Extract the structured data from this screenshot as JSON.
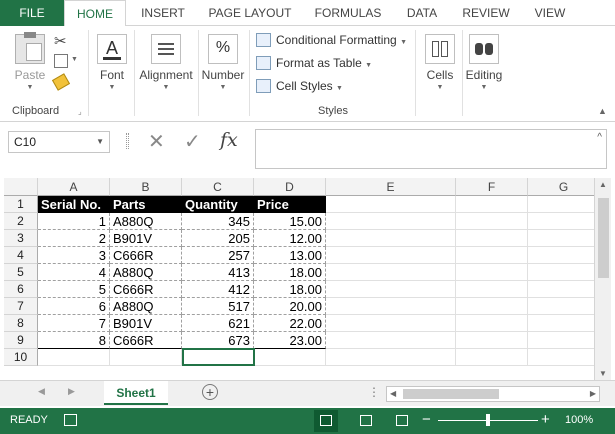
{
  "ribbon_tabs": [
    "FILE",
    "HOME",
    "INSERT",
    "PAGE LAYOUT",
    "FORMULAS",
    "DATA",
    "REVIEW",
    "VIEW"
  ],
  "clipboard": {
    "paste": "Paste",
    "group": "Clipboard"
  },
  "font": {
    "label": "Font"
  },
  "alignment": {
    "label": "Alignment"
  },
  "number": {
    "label": "Number"
  },
  "styles": {
    "conditional": "Conditional Formatting",
    "table": "Format as Table",
    "cell_styles": "Cell Styles",
    "group": "Styles"
  },
  "cells": {
    "label": "Cells"
  },
  "editing": {
    "label": "Editing"
  },
  "formula_bar": {
    "name_box": "C10",
    "fx": "fx",
    "value": ""
  },
  "columns": [
    "A",
    "B",
    "C",
    "D",
    "E",
    "F",
    "G"
  ],
  "rows": [
    "1",
    "2",
    "3",
    "4",
    "5",
    "6",
    "7",
    "8",
    "9",
    "10"
  ],
  "table": {
    "headers": [
      "Serial No.",
      "Parts",
      "Quantity",
      "Price"
    ],
    "data": [
      [
        "1",
        "A880Q",
        "345",
        "15.00"
      ],
      [
        "2",
        "B901V",
        "205",
        "12.00"
      ],
      [
        "3",
        "C666R",
        "257",
        "13.00"
      ],
      [
        "4",
        "A880Q",
        "413",
        "18.00"
      ],
      [
        "5",
        "C666R",
        "412",
        "18.00"
      ],
      [
        "6",
        "A880Q",
        "517",
        "20.00"
      ],
      [
        "7",
        "B901V",
        "621",
        "22.00"
      ],
      [
        "8",
        "C666R",
        "673",
        "23.00"
      ]
    ]
  },
  "sheets": [
    "Sheet1"
  ],
  "status": {
    "mode": "READY",
    "zoom": "100%"
  },
  "colors": {
    "accent": "#217346",
    "header_fill": "#000000"
  }
}
